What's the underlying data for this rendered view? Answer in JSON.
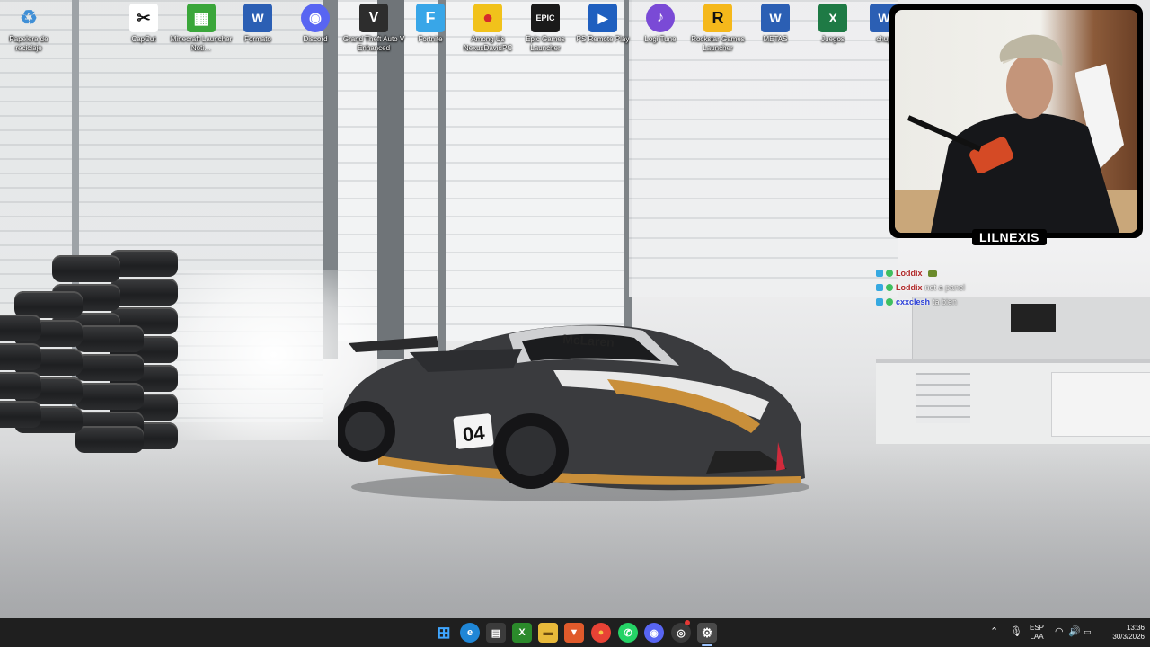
{
  "desktop_icons": [
    {
      "label": "Papelera de reciclaje",
      "icon": "recycle-bin-icon",
      "color": "#3f8fd6"
    },
    {
      "label": "CapCut",
      "icon": "capcut-icon",
      "color": "#111111"
    },
    {
      "label": "Minecraft Launcher Noti…",
      "icon": "minecraft-icon",
      "color": "#3aa63a"
    },
    {
      "label": "Formato",
      "icon": "word-doc-icon",
      "color": "#2b5fb4"
    },
    {
      "label": "Discord",
      "icon": "discord-icon",
      "color": "#5865f2"
    },
    {
      "label": "Grand Theft Auto V Enhanced",
      "icon": "gta-icon",
      "color": "#2d2d2d"
    },
    {
      "label": "Fortnite",
      "icon": "fortnite-icon",
      "color": "#38a6e8"
    },
    {
      "label": "Among Us NexusDavidPC",
      "icon": "among-us-icon",
      "color": "#d62a2a"
    },
    {
      "label": "Epic Games Launcher",
      "icon": "epic-games-icon",
      "color": "#1a1a1a"
    },
    {
      "label": "PS Remote Play",
      "icon": "ps-remote-play-icon",
      "color": "#1f5fbf"
    },
    {
      "label": "Logi Tune",
      "icon": "logi-tune-icon",
      "color": "#7a4ad6"
    },
    {
      "label": "Rockstar Games Launcher",
      "icon": "rockstar-icon",
      "color": "#f5b81b"
    },
    {
      "label": "METAS",
      "icon": "word-doc-icon",
      "color": "#2b5fb4"
    },
    {
      "label": "Juegos",
      "icon": "excel-icon",
      "color": "#1e7a45"
    },
    {
      "label": "chup",
      "icon": "word-doc-icon",
      "color": "#2b5fb4"
    }
  ],
  "icon_glyphs": [
    "♻",
    "✂",
    "▦",
    "W",
    "◉",
    "V",
    "F",
    "●",
    "EPIC",
    "▶",
    "♪",
    "R",
    "W",
    "X",
    "W"
  ],
  "webcam": {
    "name": "LILNEXIS"
  },
  "chat": [
    {
      "user": "Loddix",
      "message": "",
      "user_color": "#b02828"
    },
    {
      "user": "Loddix",
      "message": "not a panel",
      "user_color": "#b02828"
    },
    {
      "user": "cxxclesh",
      "message": "ta bien",
      "user_color": "#2c40d9"
    }
  ],
  "taskbar": {
    "apps": [
      {
        "name": "start-button",
        "glyph": "⊞",
        "color": "#3fa6ff"
      },
      {
        "name": "edge-icon",
        "glyph": "e",
        "color": "#1f86d6"
      },
      {
        "name": "microsoft-store-icon",
        "glyph": "▤",
        "color": "#333"
      },
      {
        "name": "xbox-icon",
        "glyph": "X",
        "color": "#2b8a2b"
      },
      {
        "name": "file-explorer-icon",
        "glyph": "▬",
        "color": "#e8b93a"
      },
      {
        "name": "brave-icon",
        "glyph": "▼",
        "color": "#e05a2b"
      },
      {
        "name": "chrome-icon",
        "glyph": "●",
        "color": "#e84235"
      },
      {
        "name": "whatsapp-icon",
        "glyph": "✆",
        "color": "#25d366"
      },
      {
        "name": "discord-taskbar-icon",
        "glyph": "◉",
        "color": "#5865f2"
      },
      {
        "name": "obs-icon",
        "glyph": "◎",
        "color": "#3a3a3a"
      },
      {
        "name": "settings-icon",
        "glyph": "⚙",
        "color": "#6b6b6b"
      }
    ],
    "language": "ESP",
    "layout": "LAA",
    "time": "13:36",
    "date": "30/3/2026"
  },
  "wallpaper": {
    "car_number": "04",
    "car_brand": "McLaren"
  }
}
